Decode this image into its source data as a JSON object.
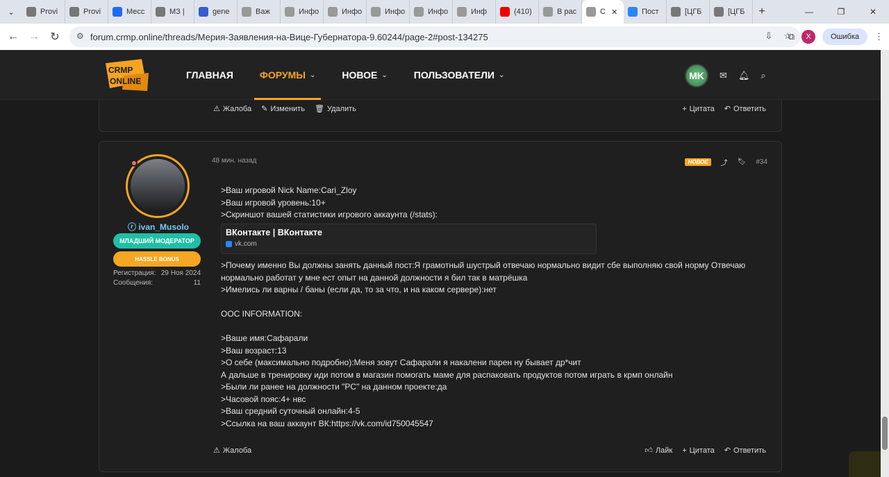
{
  "browser": {
    "tabs": [
      {
        "label": "Provi",
        "color": "#777"
      },
      {
        "label": "Provi",
        "color": "#777"
      },
      {
        "label": "Месс",
        "color": "#1e6cf2"
      },
      {
        "label": "МЗ |",
        "color": "#777"
      },
      {
        "label": "gene",
        "color": "#3a5ccc"
      },
      {
        "label": "Важ",
        "color": "#999"
      },
      {
        "label": "Инфо",
        "color": "#999"
      },
      {
        "label": "Инфо",
        "color": "#999"
      },
      {
        "label": "Инфо",
        "color": "#999"
      },
      {
        "label": "Инфо",
        "color": "#999"
      },
      {
        "label": "Инф",
        "color": "#999"
      },
      {
        "label": "(410)",
        "color": "#e00"
      },
      {
        "label": "В рас",
        "color": "#999"
      },
      {
        "label": "С",
        "color": "#999",
        "active": true
      },
      {
        "label": "Пост",
        "color": "#2787f5"
      },
      {
        "label": "[ЦГБ",
        "color": "#777"
      },
      {
        "label": "[ЦГБ",
        "color": "#777"
      }
    ],
    "url": "forum.crmp.online/threads/Мерия-Заявления-на-Вице-Губернатора-9.60244/page-2#post-134275",
    "error_label": "Ошибка",
    "profile_initial": "X"
  },
  "header": {
    "nav": [
      {
        "label": "ГЛАВНАЯ",
        "active": false,
        "dropdown": false
      },
      {
        "label": "ФОРУМЫ",
        "active": true,
        "dropdown": true
      },
      {
        "label": "НОВОЕ",
        "active": false,
        "dropdown": true
      },
      {
        "label": "ПОЛЬЗОВАТЕЛИ",
        "active": false,
        "dropdown": true
      }
    ],
    "avatar_initials": "MK"
  },
  "prev_post": {
    "report": "Жалоба",
    "edit": "Изменить",
    "delete": "Удалить",
    "quote": "Цитата",
    "reply": "Ответить"
  },
  "post": {
    "time": "48 мин. назад",
    "new_tag": "НОВОЕ",
    "number": "#34",
    "user": {
      "name": "ivan_Musolo",
      "badge1": "МЛАДШИЙ МОДЕРАТОР",
      "badge2": "HASSLE BONUS",
      "reg_label": "Регистрация:",
      "reg_value": "29 Ноя 2024",
      "msg_label": "Сообщения:",
      "msg_value": "11"
    },
    "lines_top": [
      ">Ваш игровой Nick Name:Cari_Zloy",
      ">Ваш игровой уровень:10+",
      ">Скриншот вашей статистики игрового аккаунта (/stats):"
    ],
    "embed": {
      "title": "ВКонтакте | ВКонтакте",
      "domain": "vk.com"
    },
    "lines_bottom": [
      ">Почему именно Вы должны занять данный пост:Я грамотный шустрый отвечаю нормально видит сбе выполняю свой норму Отвечаю",
      "нормально работат у мне ест опыт на данной должности я бил так в матрёшка",
      ">Имелись ли варны / баны (если да, то за что, и на каком сервере):нет",
      "",
      "OOC INFORMATION:",
      "",
      ">Ваше имя:Сафарали",
      ">Ваш возраст:13",
      ">О себе (максимально подробно):Меня зовут Сафарали я накалени парен ну бывает др*чит",
      "А дальше в тренировку иди потом в магазин помогать маме для распаковать продуктов потом играть в крмп онлайн",
      ">Были ли ранее на должности \"PC\" на данном проекте:да",
      ">Часовой пояс:4+ нвс",
      ">Ваш средний суточный онлайн:4-5",
      ">Ссылка на ваш аккаунт ВК:https://vk.com/id750045547"
    ],
    "actions": {
      "report": "Жалоба",
      "like": "Лайк",
      "quote": "Цитата",
      "reply": "Ответить"
    }
  },
  "colors": {
    "accent": "#f5a423",
    "moderator": "#1fbfa6",
    "bonus": "#f5a623",
    "username": "#7cc7f0"
  }
}
